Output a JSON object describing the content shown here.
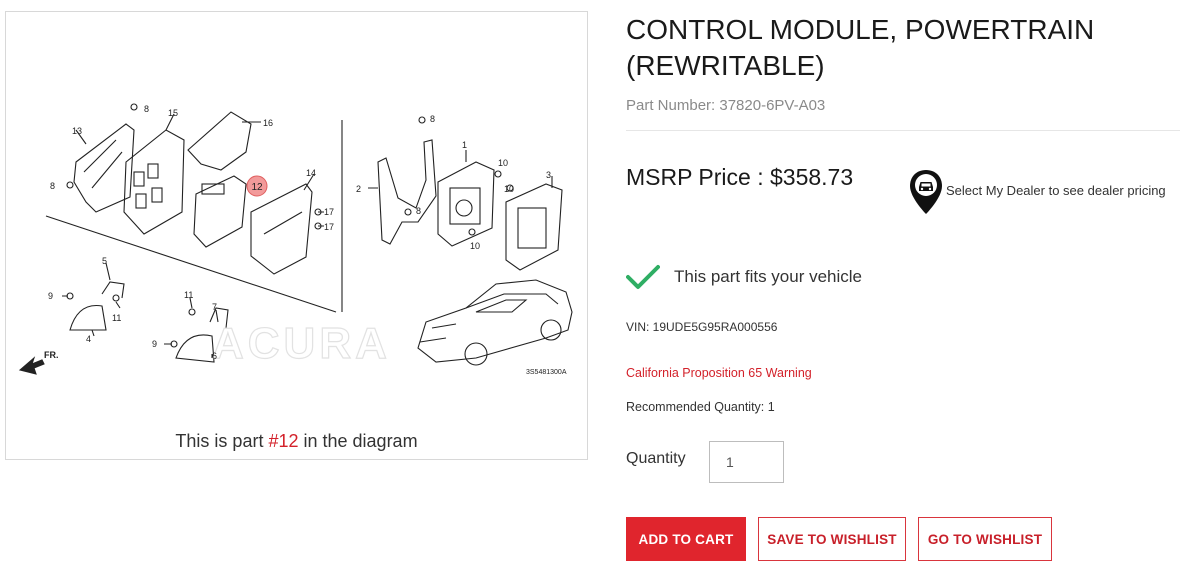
{
  "diagram": {
    "caption_prefix": "This is part ",
    "caption_part": "#12",
    "caption_suffix": " in the diagram",
    "highlight_callout": "12",
    "callouts": [
      "1",
      "2",
      "3",
      "4",
      "5",
      "6",
      "7",
      "8",
      "9",
      "10",
      "11",
      "13",
      "14",
      "15",
      "16",
      "17"
    ],
    "diagram_code": "3S5481300A",
    "front_marker": "FR.",
    "watermark": "ACURA"
  },
  "product": {
    "title": "CONTROL MODULE, POWERTRAIN (REWRITABLE)",
    "part_number": "Part Number: 37820-6PV-A03",
    "msrp": "MSRP Price : $358.73",
    "dealer_text": "Select My Dealer to see dealer pricing",
    "fits_text": "This part fits your vehicle",
    "vin": "VIN: 19UDE5G95RA000556",
    "prop65": "California Proposition 65 Warning",
    "recommended_qty": "Recommended Quantity: 1",
    "quantity_label": "Quantity",
    "quantity_value": "1"
  },
  "actions": {
    "add_to_cart": "ADD TO CART",
    "save_to_wishlist": "SAVE TO WISHLIST",
    "go_to_wishlist": "GO TO WISHLIST"
  },
  "colors": {
    "accent_red": "#e0252d",
    "check_green": "#2fae64",
    "muted_text": "#8a8a8a"
  },
  "icons": [
    "map-pin-car-icon",
    "checkmark-icon"
  ]
}
